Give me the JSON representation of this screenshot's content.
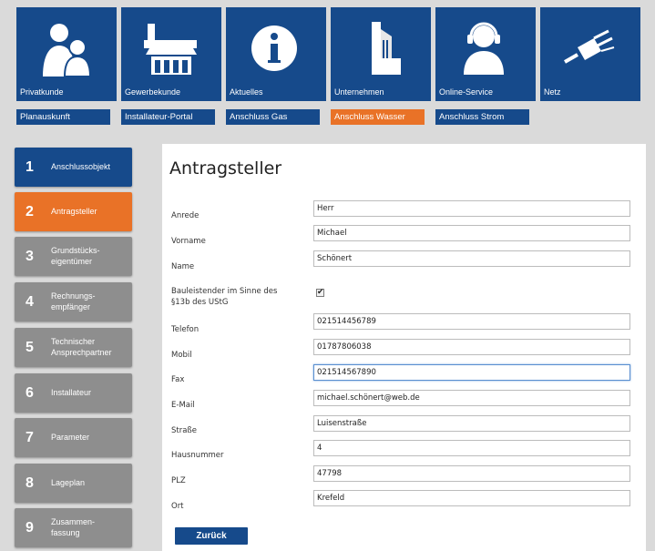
{
  "nav": {
    "tiles": [
      {
        "label": "Privatkunde",
        "icon": "family-icon"
      },
      {
        "label": "Gewerbekunde",
        "icon": "shop-icon"
      },
      {
        "label": "Aktuelles",
        "icon": "info-icon"
      },
      {
        "label": "Unternehmen",
        "icon": "building-icon"
      },
      {
        "label": "Online-Service",
        "icon": "headset-agent-icon"
      },
      {
        "label": "Netz",
        "icon": "power-plug-icon"
      }
    ],
    "sublinks": [
      "Planauskunft",
      "Installateur-Portal",
      "Anschluss Gas",
      "Anschluss Wasser",
      "Anschluss Strom"
    ]
  },
  "steps": [
    {
      "num": "1",
      "label": "Anschlussobjekt",
      "state": "done"
    },
    {
      "num": "2",
      "label": "Antragsteller",
      "state": "current"
    },
    {
      "num": "3",
      "label": "Grundstücks-\neigentümer",
      "state": "pending"
    },
    {
      "num": "4",
      "label": "Rechnungs-\nempfänger",
      "state": "pending"
    },
    {
      "num": "5",
      "label": "Technischer\nAnsprechpartner",
      "state": "pending"
    },
    {
      "num": "6",
      "label": "Installateur",
      "state": "pending"
    },
    {
      "num": "7",
      "label": "Parameter",
      "state": "pending"
    },
    {
      "num": "8",
      "label": "Lageplan",
      "state": "pending"
    },
    {
      "num": "9",
      "label": "Zusammen-\nfassung",
      "state": "pending"
    }
  ],
  "form": {
    "title": "Antragsteller",
    "labels": {
      "anrede": "Anrede",
      "vorname": "Vorname",
      "name": "Name",
      "bauleistender": "Bauleistender im Sinne des\n§13b des UStG",
      "telefon": "Telefon",
      "mobil": "Mobil",
      "fax": "Fax",
      "email": "E-Mail",
      "strasse": "Straße",
      "hausnummer": "Hausnummer",
      "plz": "PLZ",
      "ort": "Ort"
    },
    "values": {
      "anrede": "Herr",
      "vorname": "Michael",
      "name": "Schönert",
      "bauleistender_checked": true,
      "telefon": "021514456789",
      "mobil": "01787806038",
      "fax": "021514567890",
      "email": "michael.schönert@web.de",
      "strasse": "Luisenstraße",
      "hausnummer": "4",
      "plz": "47798",
      "ort": "Krefeld"
    },
    "back_label": "Zurück"
  },
  "colors": {
    "brand_blue": "#164a8b",
    "accent_orange": "#e97227",
    "step_gray": "#8e8e8e",
    "background": "#dadada"
  }
}
